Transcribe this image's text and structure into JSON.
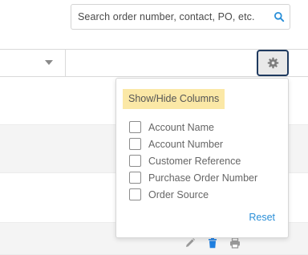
{
  "search": {
    "placeholder": "Search order number, contact, PO, etc."
  },
  "columns_panel": {
    "title": "Show/Hide Columns",
    "options": [
      {
        "label": "Account Name",
        "checked": false
      },
      {
        "label": "Account Number",
        "checked": false
      },
      {
        "label": "Customer Reference",
        "checked": false
      },
      {
        "label": "Purchase Order Number",
        "checked": false
      },
      {
        "label": "Order Source",
        "checked": false
      }
    ],
    "reset_label": "Reset"
  },
  "icons": {
    "search": "search-icon",
    "gear": "gear-icon",
    "caret": "chevron-down-icon",
    "edit": "pencil-icon",
    "delete": "trash-icon",
    "print": "printer-icon"
  },
  "colors": {
    "accent": "#2a8fd8",
    "delete_icon": "#1f7fe0",
    "gear_border": "#1f3a5f",
    "panel_title_bg": "#fbe8a6"
  }
}
